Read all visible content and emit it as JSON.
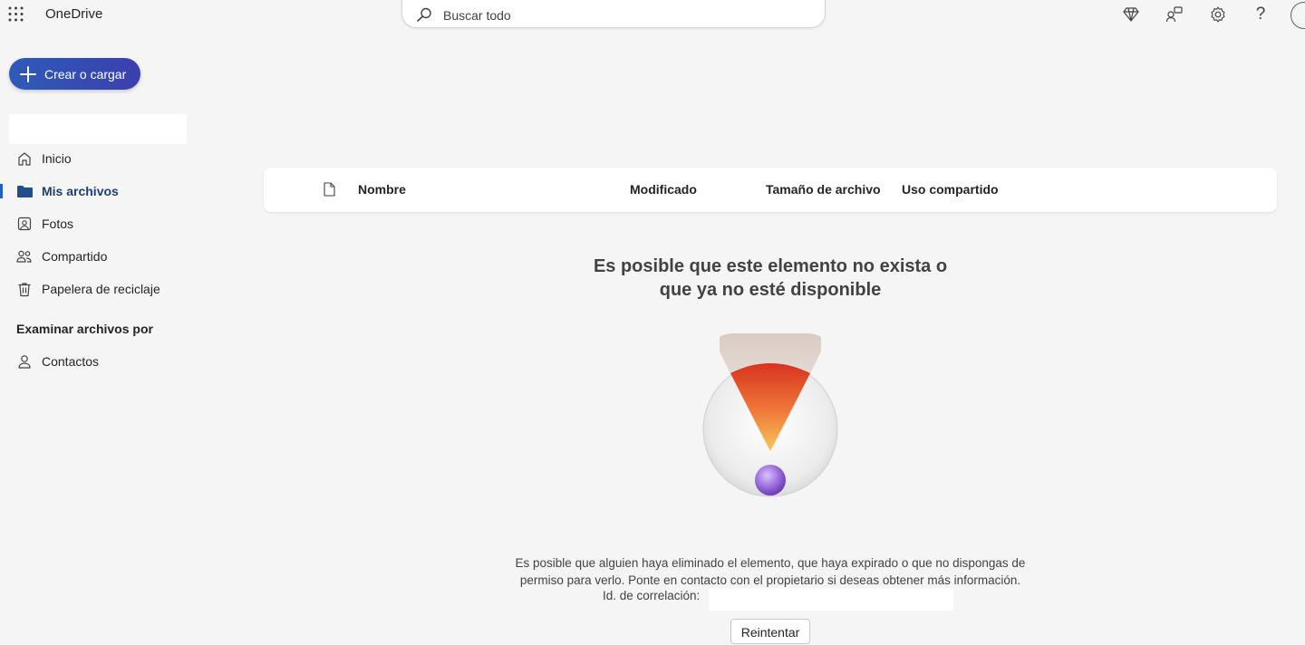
{
  "app": {
    "name": "OneDrive"
  },
  "search": {
    "placeholder": "Buscar todo"
  },
  "topbar_icons": [
    "waffle-icon",
    "premium-diamond-icon",
    "share-people-icon",
    "gear-icon",
    "help-icon",
    "avatar"
  ],
  "create_button": {
    "label": "Crear o cargar"
  },
  "sidebar": {
    "items": [
      {
        "label": "Inicio",
        "icon": "home-icon"
      },
      {
        "label": "Mis archivos",
        "icon": "folder-icon",
        "active": true
      },
      {
        "label": "Fotos",
        "icon": "photo-icon"
      },
      {
        "label": "Compartido",
        "icon": "people-icon"
      },
      {
        "label": "Papelera de reciclaje",
        "icon": "trash-icon"
      }
    ],
    "browse_heading": "Examinar archivos por",
    "browse_items": [
      {
        "label": "Contactos",
        "icon": "person-icon"
      }
    ]
  },
  "list_header": {
    "columns": [
      "Nombre",
      "Modificado",
      "Tamaño de archivo",
      "Uso compartido"
    ]
  },
  "empty_state": {
    "title_line1": "Es posible que este elemento no exista o",
    "title_line2": "que ya no esté disponible",
    "desc_line1": "Es posible que alguien haya eliminado el elemento, que haya expirado o que no dispongas de",
    "desc_line2": "permiso para verlo. Ponte en contacto con el propietario si deseas obtener más información.",
    "correlation_label": "Id. de correlación:",
    "retry_label": "Reintentar"
  },
  "colors": {
    "accent": "#2f5bb8",
    "active_nav": "#1f3f72",
    "background": "#f5f5f5"
  }
}
